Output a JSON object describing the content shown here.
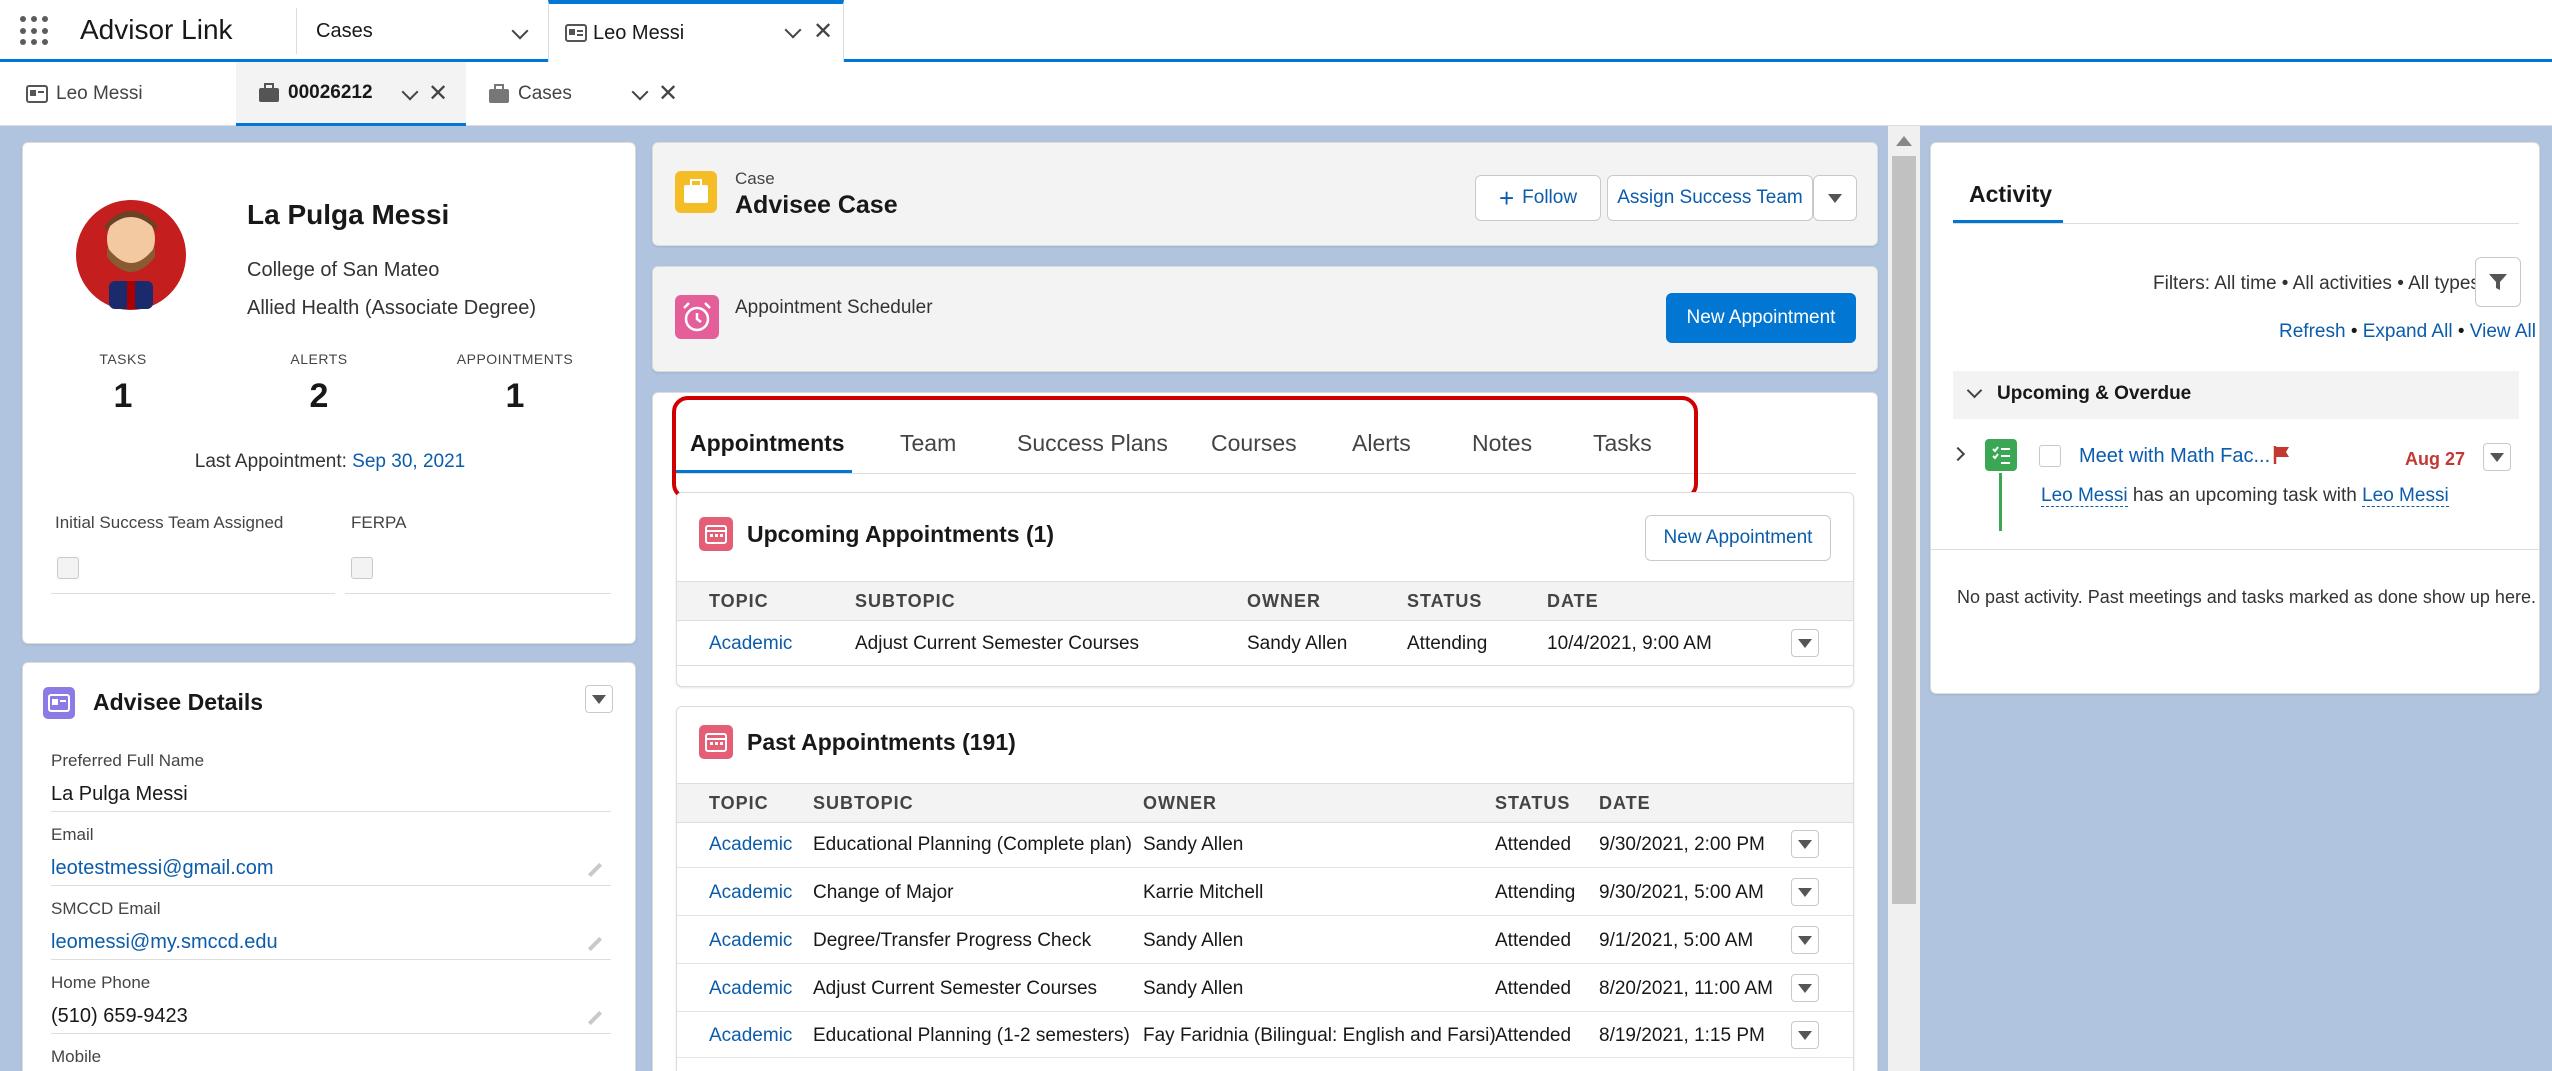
{
  "app": {
    "name": "Advisor Link"
  },
  "nav_tabs": [
    {
      "label": "Cases"
    },
    {
      "label": "Leo Messi"
    }
  ],
  "sub_tabs": [
    {
      "label": "Leo Messi"
    },
    {
      "label": "00026212"
    },
    {
      "label": "Cases"
    }
  ],
  "profile": {
    "name": "La Pulga Messi",
    "college": "College of San Mateo",
    "program": "Allied Health (Associate Degree)",
    "stats": [
      {
        "label": "TASKS",
        "value": "1"
      },
      {
        "label": "ALERTS",
        "value": "2"
      },
      {
        "label": "APPOINTMENTS",
        "value": "1"
      }
    ],
    "last_appt_label": "Last Appointment:",
    "last_appt_date": "Sep 30, 2021",
    "flag1": "Initial Success Team Assigned",
    "flag2": "FERPA"
  },
  "details": {
    "title": "Advisee Details",
    "fields": [
      {
        "label": "Preferred Full Name",
        "value": "La Pulga Messi"
      },
      {
        "label": "Email",
        "value": "leotestmessi@gmail.com"
      },
      {
        "label": "SMCCD Email",
        "value": "leomessi@my.smccd.edu"
      },
      {
        "label": "Home Phone",
        "value": "(510) 659-9423"
      },
      {
        "label": "Mobile",
        "value": ""
      }
    ]
  },
  "case": {
    "type": "Case",
    "title": "Advisee Case",
    "follow": "Follow",
    "assign": "Assign Success Team"
  },
  "scheduler": {
    "title": "Appointment Scheduler",
    "button": "New Appointment"
  },
  "tabs": [
    "Appointments",
    "Team",
    "Success Plans",
    "Courses",
    "Alerts",
    "Notes",
    "Tasks"
  ],
  "upcoming": {
    "title": "Upcoming Appointments (1)",
    "button": "New Appointment",
    "headers": [
      "TOPIC",
      "SUBTOPIC",
      "OWNER",
      "STATUS",
      "DATE"
    ],
    "rows": [
      [
        "Academic",
        "Adjust Current Semester Courses",
        "Sandy Allen",
        "Attending",
        "10/4/2021, 9:00 AM"
      ]
    ]
  },
  "past": {
    "title": "Past Appointments (191)",
    "headers": [
      "TOPIC",
      "SUBTOPIC",
      "OWNER",
      "STATUS",
      "DATE"
    ],
    "rows": [
      [
        "Academic",
        "Educational Planning (Complete plan)",
        "Sandy Allen",
        "Attended",
        "9/30/2021, 2:00 PM"
      ],
      [
        "Academic",
        "Change of Major",
        "Karrie Mitchell",
        "Attending",
        "9/30/2021, 5:00 AM"
      ],
      [
        "Academic",
        "Degree/Transfer Progress Check",
        "Sandy Allen",
        "Attended",
        "9/1/2021, 5:00 AM"
      ],
      [
        "Academic",
        "Adjust Current Semester Courses",
        "Sandy Allen",
        "Attended",
        "8/20/2021, 11:00 AM"
      ],
      [
        "Academic",
        "Educational Planning (1-2 semesters)",
        "Fay Faridnia (Bilingual: English and Farsi)",
        "Attended",
        "8/19/2021, 1:15 PM"
      ]
    ]
  },
  "activity": {
    "title": "Activity",
    "filters": "Filters: All time • All activities • All types",
    "refresh": "Refresh",
    "expand": "Expand All",
    "viewall": "View All",
    "dot": "•",
    "section": "Upcoming & Overdue",
    "task_title": "Meet with Math Fac...",
    "task_date": "Aug 27",
    "task_who": "Leo Messi",
    "task_mid": "has an upcoming task with",
    "task_with": "Leo Messi",
    "no_past": "No past activity. Past meetings and tasks marked as done show up here."
  },
  "colors": {
    "brand": "#0176d3",
    "highlight": "#d10000",
    "overdue": "#c23934"
  }
}
